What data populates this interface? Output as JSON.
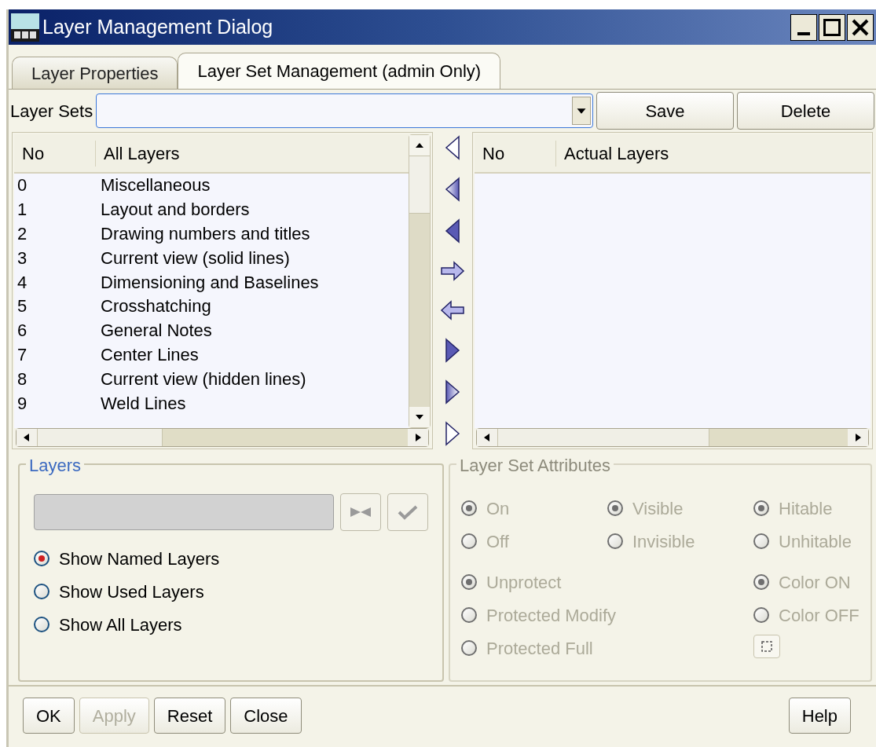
{
  "window": {
    "title": "Layer Management Dialog"
  },
  "tabs": [
    {
      "label": "Layer Properties",
      "selected": false
    },
    {
      "label": "Layer Set Management (admin Only)",
      "selected": true
    }
  ],
  "layer_sets": {
    "label": "Layer Sets",
    "buttons": [
      "Save",
      "Delete"
    ]
  },
  "all_layers": {
    "columns": [
      "No",
      "All Layers"
    ],
    "rows": [
      {
        "no": "0",
        "name": "Miscellaneous"
      },
      {
        "no": "1",
        "name": "Layout and borders"
      },
      {
        "no": "2",
        "name": "Drawing numbers and titles"
      },
      {
        "no": "3",
        "name": "Current view (solid lines)"
      },
      {
        "no": "4",
        "name": "Dimensioning and Baselines"
      },
      {
        "no": "5",
        "name": "Crosshatching"
      },
      {
        "no": "6",
        "name": "General Notes"
      },
      {
        "no": "7",
        "name": "Center Lines"
      },
      {
        "no": "8",
        "name": "Current view (hidden lines)"
      },
      {
        "no": "9",
        "name": "Weld Lines"
      }
    ]
  },
  "actual_layers": {
    "columns": [
      "No",
      "Actual Layers"
    ]
  },
  "layers": {
    "title": "Layers",
    "options": [
      {
        "label": "Show Named Layers",
        "selected": true
      },
      {
        "label": "Show Used Layers",
        "selected": false
      },
      {
        "label": "Show All Layers",
        "selected": false
      }
    ]
  },
  "attributes": {
    "title": "Layer Set Attributes",
    "disabled": true,
    "groups": [
      {
        "options": [
          {
            "label": "On",
            "selected": true
          },
          {
            "label": "Off",
            "selected": false
          }
        ]
      },
      {
        "options": [
          {
            "label": "Visible",
            "selected": true
          },
          {
            "label": "Invisible",
            "selected": false
          }
        ]
      },
      {
        "options": [
          {
            "label": "Hitable",
            "selected": true
          },
          {
            "label": "Unhitable",
            "selected": false
          }
        ]
      },
      {
        "options": [
          {
            "label": "Unprotect",
            "selected": true
          },
          {
            "label": "Protected Modify",
            "selected": false
          },
          {
            "label": "Protected Full",
            "selected": false
          }
        ]
      },
      {
        "options": [
          {
            "label": "Color ON",
            "selected": true
          },
          {
            "label": "Color OFF",
            "selected": false
          }
        ]
      }
    ]
  },
  "footer": {
    "buttons": [
      {
        "label": "OK",
        "disabled": false
      },
      {
        "label": "Apply",
        "disabled": true
      },
      {
        "label": "Reset",
        "disabled": false
      },
      {
        "label": "Close",
        "disabled": false
      }
    ],
    "help": "Help"
  }
}
